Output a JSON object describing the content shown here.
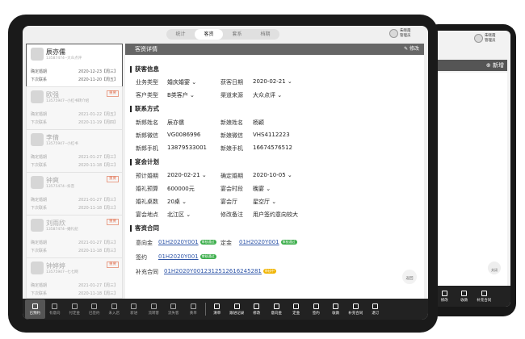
{
  "top_tabs": [
    "统计",
    "客资",
    "套系",
    "档期"
  ],
  "active_tab": 1,
  "user": {
    "name": "朱晓霞",
    "role": "管理员"
  },
  "customers": [
    {
      "name": "辰亦儒",
      "sub": "13587474--大众点评",
      "tag": "",
      "status": "",
      "r1": "确定婚期",
      "d1": "2020-12-23【周三】",
      "r2": "下次联系",
      "d2": "2020-11-20【周五】",
      "selected": true
    },
    {
      "name": "欧强",
      "sub": "13575947--小红书转介绍",
      "tag": "重要",
      "status": "",
      "r1": "确定婚期",
      "d1": "2021-01-22【周五】",
      "r2": "下次联系",
      "d2": "2020-11-19【周四】",
      "selected": false
    },
    {
      "name": "李倩",
      "sub": "13575947--小红书",
      "tag": "",
      "status": "",
      "r1": "确定婚期",
      "d1": "2021-01-27【周三】",
      "r2": "下次联系",
      "d2": "2020-11-18【周三】",
      "selected": false
    },
    {
      "name": "钟爽",
      "sub": "13575474--抖音",
      "tag": "重要",
      "status": "",
      "r1": "确定婚期",
      "d1": "2021-01-27【周三】",
      "r2": "下次联系",
      "d2": "2020-11-18【周三】",
      "selected": false
    },
    {
      "name": "刘雨欣",
      "sub": "13587474--婚礼纪",
      "tag": "重要",
      "status": "",
      "r1": "确定婚期",
      "d1": "2021-01-27【周三】",
      "r2": "下次联系",
      "d2": "2020-11-18【周三】",
      "selected": false
    },
    {
      "name": "钟婷婷",
      "sub": "13575947--七七网",
      "tag": "重要",
      "status": "",
      "r1": "确定婚期",
      "d1": "2021-01-27【周三】",
      "r2": "下次联系",
      "d2": "2020-11-18【周三】",
      "selected": false
    }
  ],
  "detail": {
    "header": "客资详情",
    "edit": "✎ 修改",
    "sec1": "获客信息",
    "biz_type_l": "业务类型",
    "biz_type_v": "婚庆婚宴 ⌄",
    "get_date_l": "获客日期",
    "get_date_v": "2020-02-21 ⌄",
    "cust_type_l": "客户类型",
    "cust_type_v": "B类客户 ⌄",
    "channel_l": "渠道来源",
    "channel_v": "大众点评 ⌄",
    "sec2": "联系方式",
    "groom_name_l": "新郎姓名",
    "groom_name_v": "辰亦儒",
    "bride_name_l": "新娘姓名",
    "bride_name_v": "杨颖",
    "groom_wx_l": "新郎微信",
    "groom_wx_v": "VG0086996",
    "bride_wx_l": "新娘微信",
    "bride_wx_v": "VHS4112223",
    "groom_tel_l": "新郎手机",
    "groom_tel_v": "13879533001",
    "bride_tel_l": "新娘手机",
    "bride_tel_v": "16674576512",
    "sec3": "宴会计划",
    "plan_date_l": "预计婚期",
    "plan_date_v": "2020-02-21 ⌄",
    "conf_date_l": "确定婚期",
    "conf_date_v": "2020-10-05 ⌄",
    "budget_l": "婚礼预算",
    "budget_v": "600000元",
    "period_l": "宴会时段",
    "period_v": "晚宴 ⌄",
    "tables_l": "婚礼桌数",
    "tables_v": "20桌 ⌄",
    "hall_l": "宴会厅",
    "hall_v": "星空厅 ⌄",
    "venue_l": "宴会地点",
    "venue_v": "北江区 ⌄",
    "note_l": "修改备注",
    "note_v": "用户签约意向较大",
    "sec4": "客资合同",
    "c1_l": "意向金",
    "c1_v": "01H2020Y001",
    "c1_p": "审核通过",
    "c2_l": "定金",
    "c2_v": "01H2020Y001",
    "c2_p": "审核通过",
    "c3_l": "签约",
    "c3_v": "01H2020Y001",
    "c3_p": "审核通过",
    "c4_l": "补充合同",
    "c4_v": "01H2020Y0012312512616245281",
    "c4_p": "审核中"
  },
  "bottom_left": [
    "已预约",
    "有意向",
    "付定金",
    "已签约",
    "未入店",
    "新进",
    "流转客",
    "流失客",
    "黄单"
  ],
  "bottom_right": [
    "清单",
    "跟进记录",
    "修改",
    "意向金",
    "定金",
    "签约",
    "收款",
    "补充合同",
    "退订"
  ],
  "float_btn": "返回",
  "second": {
    "user": "朱晓霞",
    "role": "管理员",
    "add": "⊕ 新增",
    "float": "关闭",
    "bar": [
      "修改",
      "收款",
      "补充合同"
    ]
  },
  "colors": {
    "pass": "#3cae4b",
    "review": "#f0b400",
    "link": "#2e55a8"
  }
}
